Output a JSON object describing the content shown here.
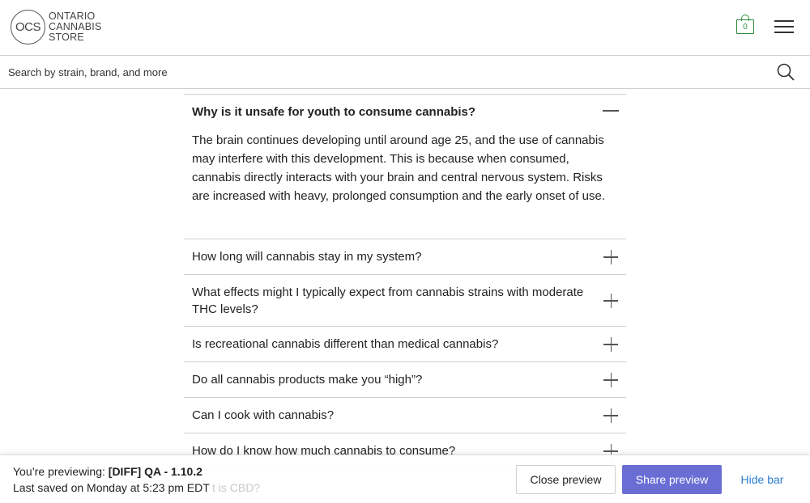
{
  "header": {
    "logo_abbr": "OCS",
    "logo_lines": [
      "ONTARIO",
      "CANNABIS",
      "STORE"
    ],
    "cart_count": "0",
    "brand_color": "#2e8b3a"
  },
  "search": {
    "placeholder": "Search by strain, brand, and more"
  },
  "faq": {
    "open_item": {
      "question": "Why is it unsafe for youth to consume cannabis?",
      "answer": "The brain continues developing until around age 25, and the use of cannabis may interfere with this development.  This is because when consumed, cannabis directly interacts with your brain and central nervous system.  Risks are increased with heavy, prolonged consumption and the early onset of use."
    },
    "items": [
      {
        "question": "How long will cannabis stay in my system?"
      },
      {
        "question": "What effects might I typically expect from cannabis strains with moderate THC levels?"
      },
      {
        "question": "Is recreational cannabis different than medical cannabis?"
      },
      {
        "question": "Do all cannabis products make you “high”?"
      },
      {
        "question": "Can I cook with cannabis?"
      },
      {
        "question": "How do I know how much cannabis to consume?"
      }
    ],
    "partially_hidden_item": "What is CBD?"
  },
  "preview_bar": {
    "previewing_label": "You’re previewing:",
    "previewing_value": "[DIFF] QA - 1.10.2",
    "last_saved": "Last saved on Monday at 5:23 pm EDT",
    "ghost_text": "t is CBD?",
    "close_label": "Close preview",
    "share_label": "Share preview",
    "hide_label": "Hide bar",
    "accent_color": "#6a6ed4",
    "link_color": "#2a7bd4"
  }
}
